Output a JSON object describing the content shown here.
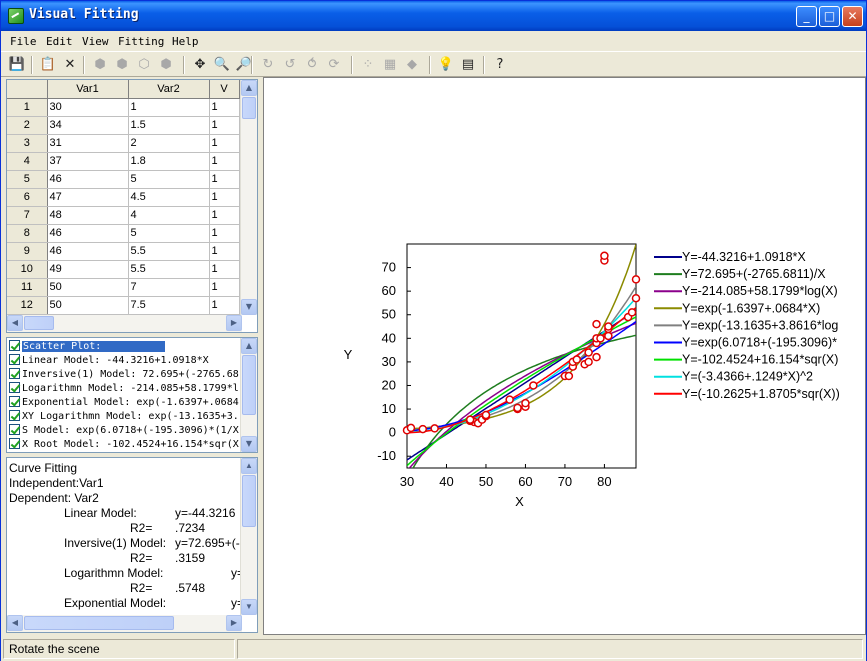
{
  "window": {
    "title": "Visual Fitting",
    "minimize": "_",
    "maximize": "□",
    "close": "✕"
  },
  "menu": [
    "File",
    "Edit",
    "View",
    "Fitting",
    "Help"
  ],
  "toolbar_icons": [
    {
      "name": "save-icon",
      "glyph": "💾",
      "disabled": false
    },
    {
      "name": "copy-icon",
      "glyph": "📋",
      "disabled": false
    },
    {
      "name": "delete-icon",
      "glyph": "✕",
      "disabled": false
    },
    {
      "name": "cube-front-icon",
      "glyph": "⬢",
      "disabled": true
    },
    {
      "name": "cube-side-icon",
      "glyph": "⬢",
      "disabled": true
    },
    {
      "name": "cube-top-icon",
      "glyph": "⬡",
      "disabled": true
    },
    {
      "name": "cube-solid-icon",
      "glyph": "⬢",
      "disabled": true
    },
    {
      "name": "move-icon",
      "glyph": "✥",
      "disabled": false
    },
    {
      "name": "zoom-window-icon",
      "glyph": "🔍",
      "disabled": false
    },
    {
      "name": "zoom-icon",
      "glyph": "🔎",
      "disabled": false
    },
    {
      "name": "rotate-x-icon",
      "glyph": "↻",
      "disabled": true
    },
    {
      "name": "rotate-y-icon",
      "glyph": "↺",
      "disabled": true
    },
    {
      "name": "rotate-z-icon",
      "glyph": "⥀",
      "disabled": true
    },
    {
      "name": "rotate-free-icon",
      "glyph": "⟳",
      "disabled": true
    },
    {
      "name": "points-icon",
      "glyph": "⁘",
      "disabled": true
    },
    {
      "name": "mesh-icon",
      "glyph": "▦",
      "disabled": true
    },
    {
      "name": "surface-icon",
      "glyph": "◆",
      "disabled": true
    },
    {
      "name": "light-icon",
      "glyph": "💡",
      "disabled": false
    },
    {
      "name": "grid-view-icon",
      "glyph": "▤",
      "disabled": false
    },
    {
      "name": "help-icon",
      "glyph": "?",
      "disabled": false
    }
  ],
  "table": {
    "columns": [
      "",
      "Var1",
      "Var2",
      "V"
    ],
    "rows": [
      [
        "1",
        "30",
        "1",
        "1"
      ],
      [
        "2",
        "34",
        "1.5",
        "1"
      ],
      [
        "3",
        "31",
        "2",
        "1"
      ],
      [
        "4",
        "37",
        "1.8",
        "1"
      ],
      [
        "5",
        "46",
        "5",
        "1"
      ],
      [
        "6",
        "47",
        "4.5",
        "1"
      ],
      [
        "7",
        "48",
        "4",
        "1"
      ],
      [
        "8",
        "46",
        "5",
        "1"
      ],
      [
        "9",
        "46",
        "5.5",
        "1"
      ],
      [
        "10",
        "49",
        "5.5",
        "1"
      ],
      [
        "11",
        "50",
        "7",
        "1"
      ],
      [
        "12",
        "50",
        "7.5",
        "1"
      ]
    ]
  },
  "models": [
    "Scatter Plot:",
    "Linear Model: -44.3216+1.0918*X",
    "Inversive(1) Model: 72.695+(-2765.68",
    "Logarithmn Model: -214.085+58.1799*l",
    "Exponential Model: exp(-1.6397+.0684",
    "XY Logarithmn Model: exp(-13.1635+3.",
    "S Model: exp(6.0718+(-195.3096)*(1/X",
    "X Root Model: -102.4524+16.154*sqr(X"
  ],
  "results": {
    "heading": "Curve Fitting",
    "independent": "Independent:Var1",
    "dependent": "Dependent: Var2",
    "entries": [
      {
        "label": "Linear Model:",
        "value": "y=-44.3216",
        "r2_label": "R2=",
        "r2": ".7234"
      },
      {
        "label": "Inversive(1) Model:",
        "value": "y=72.695+(-",
        "r2_label": "R2=",
        "r2": ".3159"
      },
      {
        "label": "Logarithmn Model:",
        "value": "y=",
        "r2_label": "R2=",
        "r2": ".5748"
      },
      {
        "label": "Exponential Model:",
        "value": "y="
      }
    ]
  },
  "status": {
    "text": "Rotate the scene"
  },
  "chart_data": {
    "type": "line",
    "xlabel": "X",
    "ylabel": "Y",
    "xlim": [
      30,
      88
    ],
    "ylim": [
      -15,
      80
    ],
    "xticks": [
      30,
      40,
      50,
      60,
      70,
      80
    ],
    "yticks": [
      -10,
      0,
      10,
      20,
      30,
      40,
      50,
      60,
      70
    ],
    "legend_position": "right",
    "scatter": [
      [
        30,
        1
      ],
      [
        31,
        2
      ],
      [
        34,
        1.5
      ],
      [
        37,
        1.8
      ],
      [
        46,
        5
      ],
      [
        47,
        4.5
      ],
      [
        48,
        4
      ],
      [
        46,
        5
      ],
      [
        46,
        5.5
      ],
      [
        49,
        5.5
      ],
      [
        50,
        7
      ],
      [
        50,
        7.5
      ],
      [
        56,
        14
      ],
      [
        58,
        10
      ],
      [
        58,
        10.5
      ],
      [
        60,
        11
      ],
      [
        60,
        12.5
      ],
      [
        62,
        20
      ],
      [
        70,
        24
      ],
      [
        71,
        24
      ],
      [
        72,
        28
      ],
      [
        72,
        30
      ],
      [
        73,
        31
      ],
      [
        75,
        29
      ],
      [
        76,
        30
      ],
      [
        76,
        34
      ],
      [
        78,
        32
      ],
      [
        78,
        38
      ],
      [
        78,
        40
      ],
      [
        78,
        46
      ],
      [
        79,
        40
      ],
      [
        80,
        73
      ],
      [
        80,
        75
      ],
      [
        81,
        41
      ],
      [
        81,
        44
      ],
      [
        81,
        45
      ],
      [
        86,
        49
      ],
      [
        87,
        51
      ],
      [
        88,
        57
      ],
      [
        88,
        65
      ]
    ],
    "series": [
      {
        "name": "Y=-44.3216+1.0918*X",
        "color": "#00008b",
        "model": "linear",
        "a": -44.3216,
        "b": 1.0918
      },
      {
        "name": "Y=72.695+(-2765.6811)/X",
        "color": "#1e7d1e",
        "model": "inverse",
        "a": 72.695,
        "b": -2765.6811
      },
      {
        "name": "Y=-214.085+58.1799*log(X)",
        "color": "#8b008b",
        "model": "log",
        "a": -214.085,
        "b": 58.1799
      },
      {
        "name": "Y=exp(-1.6397+.0684*X)",
        "color": "#8b8b00",
        "model": "exp",
        "a": -1.6397,
        "b": 0.0684
      },
      {
        "name": "Y=exp(-13.1635+3.8616*log",
        "color": "#808080",
        "model": "power",
        "a": -13.1635,
        "b": 3.8616
      },
      {
        "name": "Y=exp(6.0718+(-195.3096)*",
        "color": "#0000ff",
        "model": "s",
        "a": 6.0718,
        "b": -195.3096
      },
      {
        "name": "Y=-102.4524+16.154*sqr(X)",
        "color": "#00e000",
        "model": "sqrt",
        "a": -102.4524,
        "b": 16.154
      },
      {
        "name": "Y=(-3.4366+.1249*X)^2",
        "color": "#00e0e0",
        "model": "square",
        "a": -3.4366,
        "b": 0.1249
      },
      {
        "name": "Y=(-10.2625+1.8705*sqr(X))",
        "color": "#ff0000",
        "model": "sqrtsq",
        "a": -10.2625,
        "b": 1.8705
      }
    ]
  }
}
